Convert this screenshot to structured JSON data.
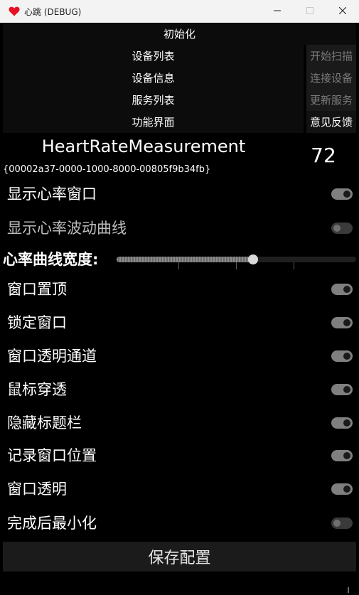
{
  "window": {
    "title": "心跳 (DEBUG)",
    "icon": "heart-icon",
    "accent": "#e81123"
  },
  "menu": {
    "init_label": "初始化",
    "left": [
      {
        "label": "设备列表"
      },
      {
        "label": "设备信息"
      },
      {
        "label": "服务列表"
      },
      {
        "label": "功能界面"
      }
    ],
    "right": [
      {
        "label": "开始扫描",
        "enabled": false
      },
      {
        "label": "连接设备",
        "enabled": false
      },
      {
        "label": "更新服务",
        "enabled": false
      },
      {
        "label": "意见反馈",
        "enabled": true
      }
    ]
  },
  "heart_rate": {
    "characteristic": "HeartRateMeasurement",
    "uuid": "{00002a37-0000-1000-8000-00805f9b34fb}",
    "value": "72"
  },
  "settings": [
    {
      "label": "显示心率窗口",
      "on": true
    },
    {
      "label": "显示心率波动曲线",
      "on": false
    },
    {
      "label": "窗口置顶",
      "on": true
    },
    {
      "label": "锁定窗口",
      "on": true
    },
    {
      "label": "窗口透明通道",
      "on": true
    },
    {
      "label": "鼠标穿透",
      "on": true
    },
    {
      "label": "隐藏标题栏",
      "on": true
    },
    {
      "label": "记录窗口位置",
      "on": true
    },
    {
      "label": "窗口透明",
      "on": true
    },
    {
      "label": "完成后最小化",
      "on": false
    }
  ],
  "curve_width": {
    "label": "心率曲线宽度:",
    "fraction": 0.57
  },
  "save_label": "保存配置"
}
